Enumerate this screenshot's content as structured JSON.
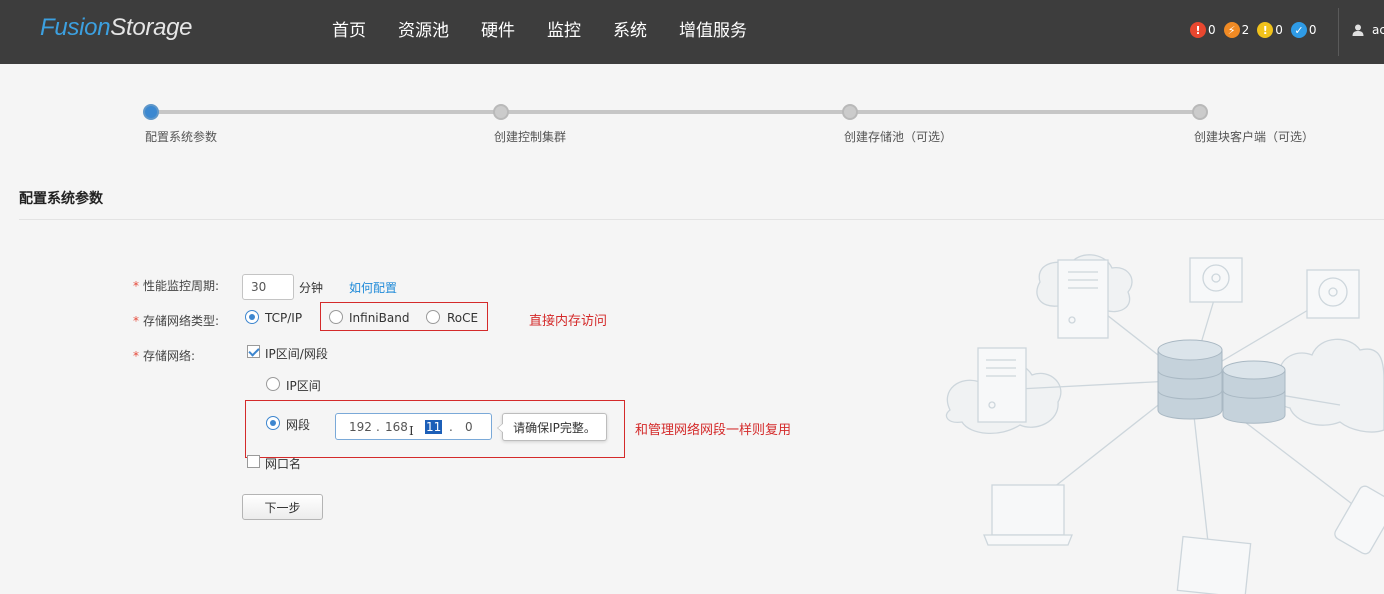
{
  "header": {
    "logo_part1": "Fusion",
    "logo_part2": "Storage",
    "nav": [
      "首页",
      "资源池",
      "硬件",
      "监控",
      "系统",
      "增值服务"
    ],
    "alarms": [
      {
        "name": "critical-alarm-icon",
        "glyph": "!",
        "color": "#e8472f",
        "count": "0"
      },
      {
        "name": "major-alarm-icon",
        "glyph": "⚡",
        "color": "#f08a24",
        "count": "2"
      },
      {
        "name": "minor-alarm-icon",
        "glyph": "!",
        "color": "#f1c21b",
        "count": "0"
      },
      {
        "name": "warning-alarm-icon",
        "glyph": "✓",
        "color": "#2f9be6",
        "count": "0"
      }
    ],
    "user_name": "ac"
  },
  "steps": [
    {
      "label": "配置系统参数",
      "active": true
    },
    {
      "label": "创建控制集群",
      "active": false
    },
    {
      "label": "创建存储池（可选）",
      "active": false
    },
    {
      "label": "创建块客户端（可选）",
      "active": false
    }
  ],
  "section_title": "配置系统参数",
  "form": {
    "required_mark": "*",
    "perf_period_label": "性能监控周期:",
    "perf_period_value": "30",
    "perf_period_unit": "分钟",
    "how_to_config_link": "如何配置",
    "network_type_label": "存储网络类型:",
    "network_types": [
      {
        "label": "TCP/IP",
        "checked": true
      },
      {
        "label": "InfiniBand",
        "checked": false
      },
      {
        "label": "RoCE",
        "checked": false
      }
    ],
    "storage_network_label": "存储网络:",
    "ip_range_subnet_label": "IP区间/网段",
    "ip_range_subnet_checked": true,
    "ip_range_label": "IP区间",
    "ip_range_checked": false,
    "subnet_label": "网段",
    "subnet_checked": true,
    "ip_octets": [
      "192",
      "168",
      "11",
      "0"
    ],
    "ip_separator": ".",
    "ip_tooltip": "请确保IP完整。",
    "port_name_label": "网口名",
    "port_name_checked": false,
    "next_button": "下一步"
  },
  "annotations": {
    "network_type_note": "直接内存访问",
    "subnet_note": "和管理网络网段一样则复用"
  },
  "accent_color": "#3b88d1",
  "annotation_color": "#d42a2a"
}
